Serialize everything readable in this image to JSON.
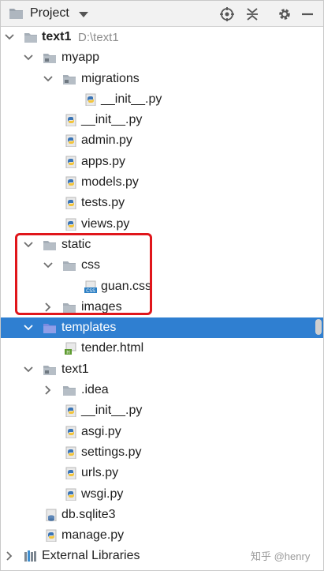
{
  "header": {
    "title": "Project",
    "tools": [
      "locate-icon",
      "collapse-all-icon",
      "settings-icon",
      "hide-icon"
    ]
  },
  "colors": {
    "selection": "#2f7fd1",
    "folder": "#a5aeb7",
    "folder_selected": "#7a8be0",
    "highlight_box": "#e0161b",
    "python_blue": "#3a74b5",
    "python_yellow": "#f3c53b"
  },
  "tree": {
    "root": {
      "label": "text1",
      "path": "D:\\text1"
    },
    "myapp": "myapp",
    "migrations": "migrations",
    "migrations_init": "__init__.py",
    "myapp_init": "__init__.py",
    "admin": "admin.py",
    "apps": "apps.py",
    "models": "models.py",
    "tests": "tests.py",
    "views": "views.py",
    "static": "static",
    "css": "css",
    "guan_css": "guan.css",
    "images": "images",
    "templates": "templates",
    "tender": "tender.html",
    "text1_pkg": "text1",
    "idea": ".idea",
    "text1_init": "__init__.py",
    "asgi": "asgi.py",
    "settings": "settings.py",
    "urls": "urls.py",
    "wsgi": "wsgi.py",
    "db": "db.sqlite3",
    "manage": "manage.py",
    "external": "External Libraries"
  },
  "watermark": "知乎 @henry"
}
